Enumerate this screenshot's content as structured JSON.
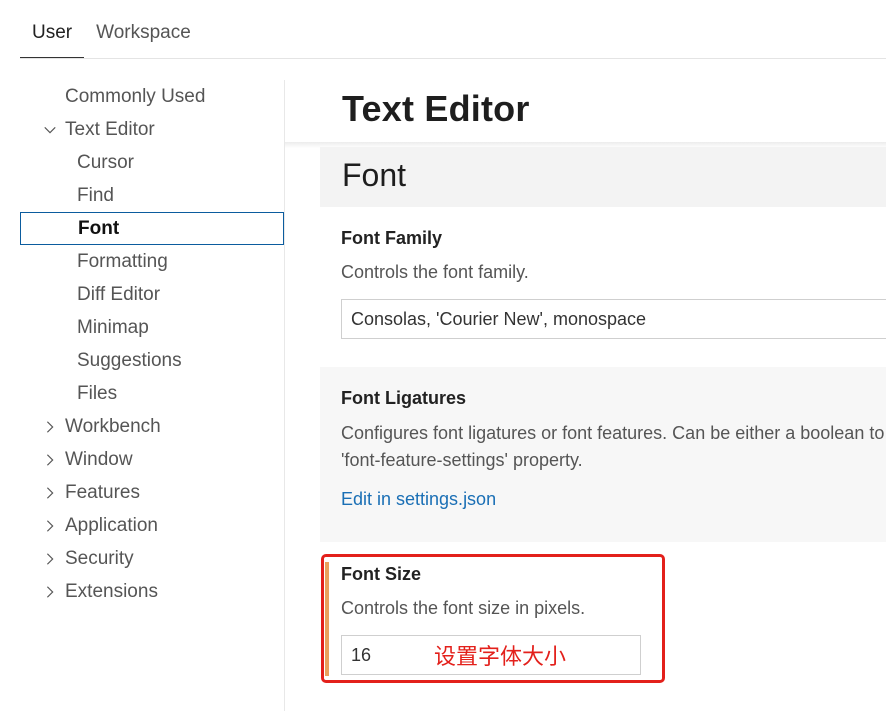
{
  "scope_tabs": [
    "User",
    "Workspace"
  ],
  "tree": {
    "items": [
      {
        "label": "Commonly Used"
      },
      {
        "label": "Text Editor"
      },
      {
        "label": "Cursor"
      },
      {
        "label": "Find"
      },
      {
        "label": "Font"
      },
      {
        "label": "Formatting"
      },
      {
        "label": "Diff Editor"
      },
      {
        "label": "Minimap"
      },
      {
        "label": "Suggestions"
      },
      {
        "label": "Files"
      },
      {
        "label": "Workbench"
      },
      {
        "label": "Window"
      },
      {
        "label": "Features"
      },
      {
        "label": "Application"
      },
      {
        "label": "Security"
      },
      {
        "label": "Extensions"
      }
    ],
    "selected": "Font"
  },
  "content": {
    "page_title": "Text Editor",
    "section_title": "Font",
    "settings": [
      {
        "title": "Font Family",
        "description": "Controls the font family.",
        "value": "Consolas, 'Courier New', monospace"
      },
      {
        "title": "Font Ligatures",
        "description_line1": "Configures font ligatures or font features. Can be either a boolean to enable/disable ligatures or a string for the value of the CSS",
        "description_line2": "'font-feature-settings' property.",
        "link": "Edit in settings.json"
      },
      {
        "title": "Font Size",
        "description": "Controls the font size in pixels.",
        "value": "16"
      }
    ]
  },
  "annotation": {
    "text": "设置字体大小",
    "color": "#e3201b"
  },
  "colors": {
    "selection_border": "#0b5c9e",
    "link": "#1a6fb5",
    "modified_indicator": "#e9a15d"
  }
}
